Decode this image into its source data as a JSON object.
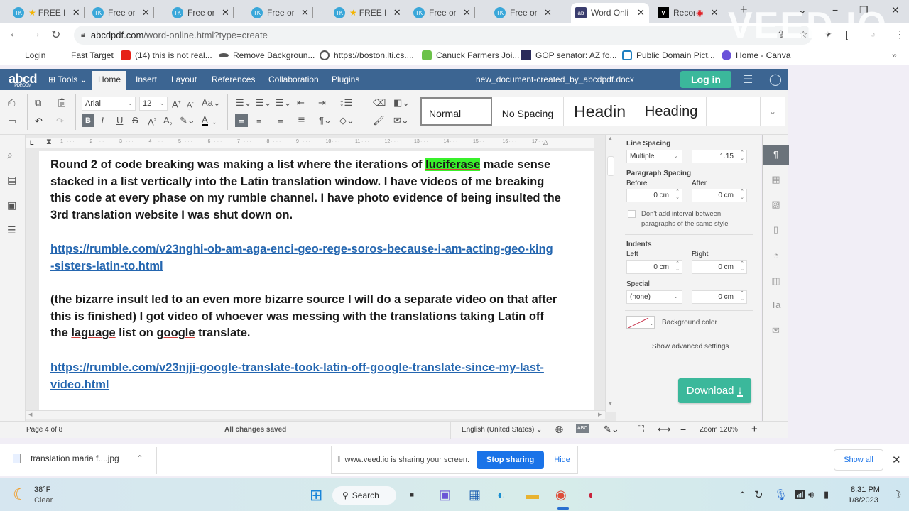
{
  "browser": {
    "tabs": [
      {
        "title": "FREE L",
        "starred": true,
        "favicon": "TK"
      },
      {
        "title": "Free onlin",
        "starred": false,
        "favicon": "TK"
      },
      {
        "title": "Free onlin",
        "starred": false,
        "favicon": "TK"
      },
      {
        "title": "Free onlin",
        "starred": false,
        "favicon": "TK"
      },
      {
        "title": "FREE L",
        "starred": true,
        "favicon": "TK"
      },
      {
        "title": "Free onlin",
        "starred": false,
        "favicon": "TK"
      },
      {
        "title": "Free onlin",
        "starred": false,
        "favicon": "TK"
      },
      {
        "title": "Word Onli",
        "starred": false,
        "favicon": "ab",
        "active": true
      },
      {
        "title": "Recor",
        "starred": false,
        "favicon": "V",
        "recording": true
      }
    ],
    "url_host": "abcdpdf.com",
    "url_path": "/word-online.html?type=create",
    "watermark": "VEED.IO",
    "bookmarks": [
      {
        "label": "Login"
      },
      {
        "label": "Fast Target"
      },
      {
        "label": "(14) this is not real..."
      },
      {
        "label": "Remove Backgroun..."
      },
      {
        "label": "https://boston.lti.cs...."
      },
      {
        "label": "Canuck Farmers Joi..."
      },
      {
        "label": "GOP senator: AZ fo..."
      },
      {
        "label": "Public Domain Pict..."
      },
      {
        "label": "Home - Canva"
      }
    ],
    "more_bookmarks": "»"
  },
  "app": {
    "logo": "abcd",
    "logo_sub": "PDF.COM",
    "tools_label": "Tools",
    "nav": [
      "Home",
      "Insert",
      "Layout",
      "References",
      "Collaboration",
      "Plugins"
    ],
    "active_nav": "Home",
    "doc_name": "new_document-created_by_abcdpdf.docx",
    "login_label": "Log in"
  },
  "toolbar": {
    "font_name": "Arial",
    "font_size": "12",
    "styles": [
      "Normal",
      "No Spacing",
      "Headin",
      "Heading",
      ""
    ],
    "selected_style": "Normal"
  },
  "ruler": {
    "ticks": [
      "1",
      "2",
      "3",
      "4",
      "5",
      "6",
      "7",
      "8",
      "9",
      "10",
      "11",
      "12",
      "13",
      "14",
      "15",
      "16",
      "17"
    ]
  },
  "document": {
    "para1_before": "Round 2 of code breaking was making a list where the iterations of ",
    "para1_highlight": "luciferase",
    "para1_after": " made sense stacked in a list vertically into the Latin translation window. I have videos of me breaking this code at every phase on my rumble channel. I have photo evidence of being insulted the 3rd translation website I was shut down on.",
    "link1": "https://rumble.com/v23nghi-ob-am-aga-enci-geo-rege-soros-because-i-am-acting-geo-king-sisters-latin-to.html",
    "para2_before": "(the bizarre insult led to an even more bizarre source I will do a separate video on that after this is finished) I got video of whoever was messing with the translations taking Latin off the ",
    "para2_misspell1": "laguage",
    "para2_mid": " list on ",
    "para2_misspell2": "google",
    "para2_after": " translate.",
    "link2": "https://rumble.com/v23njji-google-translate-took-latin-off-google-translate-since-my-last-video.html"
  },
  "right_panel": {
    "line_spacing_label": "Line Spacing",
    "line_spacing_type": "Multiple",
    "line_spacing_value": "1.15",
    "paragraph_spacing_label": "Paragraph Spacing",
    "before_label": "Before",
    "before_value": "0 cm",
    "after_label": "After",
    "after_value": "0 cm",
    "no_interval_label": "Don't add interval between paragraphs of the same style",
    "no_interval_checked": false,
    "indents_label": "Indents",
    "left_label": "Left",
    "left_value": "0 cm",
    "right_label": "Right",
    "right_value": "0 cm",
    "special_label": "Special",
    "special_value": "(none)",
    "special_amount": "0 cm",
    "bg_color_label": "Background color",
    "advanced_label": "Show advanced settings",
    "download_label": "Download"
  },
  "statusbar": {
    "page": "Page 4 of 8",
    "saved": "All changes saved",
    "language": "English (United States)",
    "zoom": "Zoom 120%"
  },
  "shelf": {
    "download_file": "translation maria f....jpg",
    "sharing_text": "www.veed.io is sharing your screen.",
    "stop_label": "Stop sharing",
    "hide_label": "Hide",
    "show_all_label": "Show all"
  },
  "taskbar": {
    "temp": "38°F",
    "weather": "Clear",
    "search_label": "Search",
    "time": "8:31 PM",
    "date": "1/8/2023"
  },
  "colors": {
    "app_header": "#3c6592",
    "accent_green": "#3bb89b",
    "highlight": "#39f02b",
    "link": "#2466b0",
    "stop_sharing": "#1a73e8"
  }
}
